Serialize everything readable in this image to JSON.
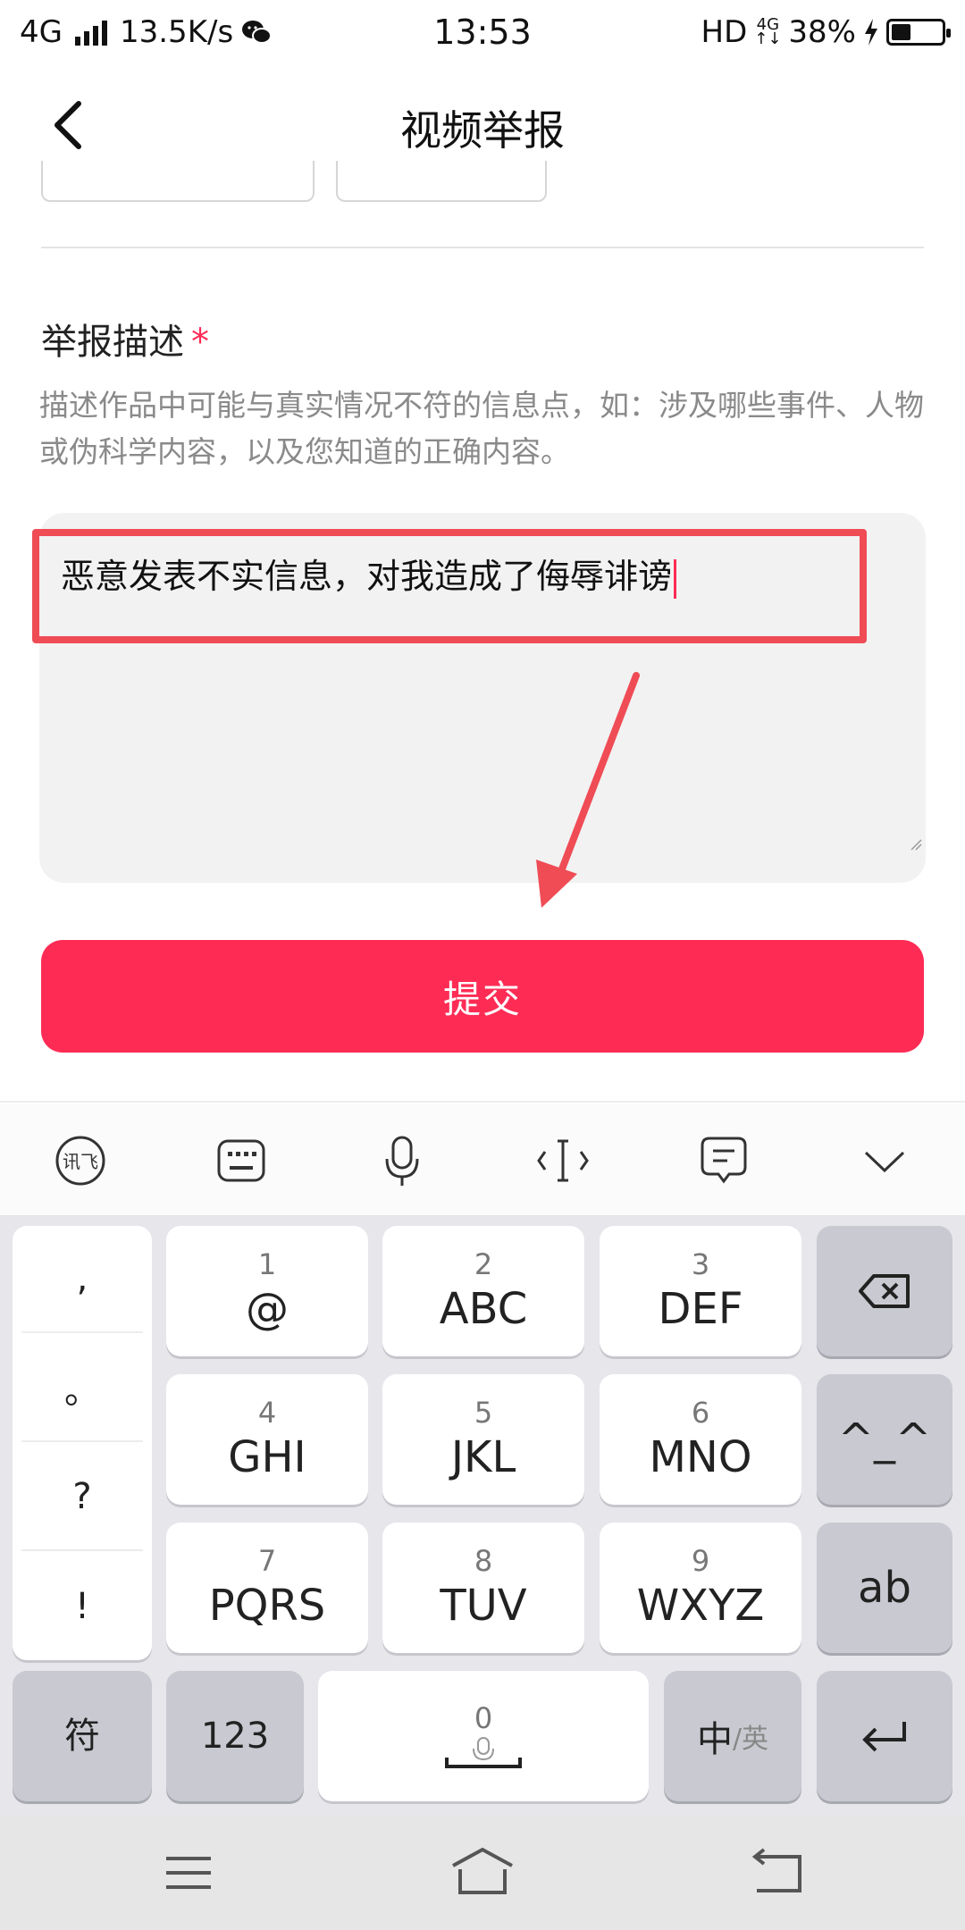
{
  "status": {
    "network": "4G",
    "speed": "13.5K/s",
    "time": "13:53",
    "hd": "HD",
    "net_small": "4G",
    "battery": "38%",
    "battery_level": 0.38
  },
  "header": {
    "title": "视频举报"
  },
  "form": {
    "section_title": "举报描述",
    "required_mark": "*",
    "hint": "描述作品中可能与真实情况不符的信息点，如：涉及哪些事件、人物或伪科学内容，以及您知道的正确内容。",
    "description_value": "恶意发表不实信息，对我造成了侮辱诽谤",
    "submit_label": "提交"
  },
  "keyboard": {
    "toolbar_icons": [
      "ifly-logo-icon",
      "keyboard-icon",
      "microphone-icon",
      "cursor-move-icon",
      "clipboard-icon",
      "collapse-chevron-icon"
    ],
    "punct": [
      ",",
      "。",
      "?",
      "!"
    ],
    "keys": [
      {
        "num": "1",
        "label": "@"
      },
      {
        "num": "2",
        "label": "ABC"
      },
      {
        "num": "3",
        "label": "DEF"
      },
      {
        "num": "4",
        "label": "GHI"
      },
      {
        "num": "5",
        "label": "JKL"
      },
      {
        "num": "6",
        "label": "MNO"
      },
      {
        "num": "7",
        "label": "PQRS"
      },
      {
        "num": "8",
        "label": "TUV"
      },
      {
        "num": "9",
        "label": "WXYZ"
      }
    ],
    "emoticon": "^_^",
    "ab": "ab",
    "symbol": "符",
    "numeric": "123",
    "space_num": "0",
    "lang_cn": "中",
    "lang_en": "/英"
  },
  "colors": {
    "accent": "#fe2c55",
    "annotation": "#ef4c56"
  }
}
